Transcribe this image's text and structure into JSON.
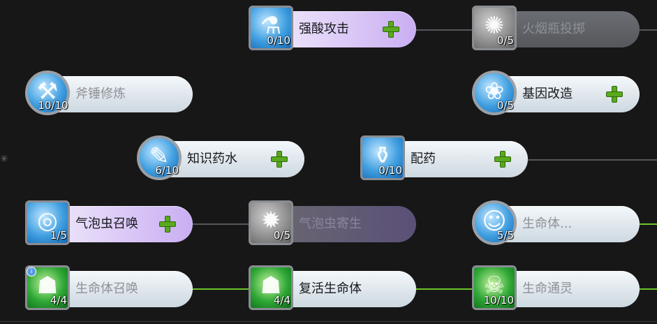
{
  "skills": [
    {
      "id": "acid",
      "name": "强酸攻击",
      "level": "0/10",
      "state": "purple",
      "icon": "acid-flask-icon",
      "glyph": "⚗"
    },
    {
      "id": "fire-bottle",
      "name": "火烟瓶投掷",
      "level": "0/5",
      "state": "locked",
      "icon": "fire-bottle-icon",
      "glyph": "✺"
    },
    {
      "id": "hammer",
      "name": "斧锤修炼",
      "level": "10/10",
      "state": "maxed",
      "icon": "hammer-icon",
      "glyph": "⚒"
    },
    {
      "id": "gene",
      "name": "基因改造",
      "level": "0/5",
      "state": "available",
      "icon": "dna-icon",
      "glyph": "❀"
    },
    {
      "id": "knowledge",
      "name": "知识药水",
      "level": "6/10",
      "state": "available",
      "icon": "potion-icon",
      "glyph": "✎"
    },
    {
      "id": "mix",
      "name": "配药",
      "level": "0/10",
      "state": "available",
      "icon": "flask-icon",
      "glyph": "⚱"
    },
    {
      "id": "bubble",
      "name": "气泡虫召唤",
      "level": "1/5",
      "state": "purple",
      "icon": "bubble-spiral-icon",
      "glyph": "◎"
    },
    {
      "id": "parasite",
      "name": "气泡虫寄生",
      "level": "0/5",
      "state": "lockedpurple",
      "icon": "parasite-icon",
      "glyph": "✹"
    },
    {
      "id": "lifeform",
      "name": "生命体...",
      "level": "5/5",
      "state": "maxed",
      "icon": "lifeform-face-icon",
      "glyph": "☺"
    },
    {
      "id": "summon-life",
      "name": "生命体召唤",
      "level": "4/4",
      "state": "maxed",
      "icon": "summon-figure-icon",
      "glyph": "☗",
      "info": "i"
    },
    {
      "id": "revive",
      "name": "复活生命体",
      "level": "4/4",
      "state": "maxed",
      "icon": "revive-angel-icon",
      "glyph": "☗"
    },
    {
      "id": "spirit",
      "name": "生命通灵",
      "level": "10/10",
      "state": "maxed",
      "icon": "spirit-skull-icon",
      "glyph": "☠"
    }
  ]
}
